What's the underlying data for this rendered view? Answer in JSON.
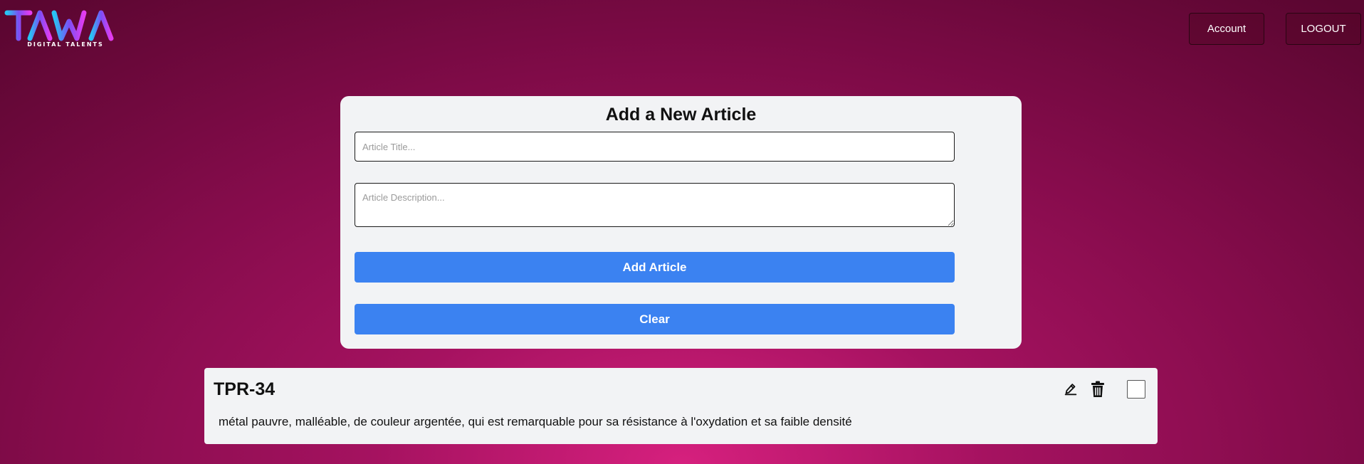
{
  "header": {
    "logo_text": "TAWA",
    "logo_subtitle": "DIGITAL TALENTS",
    "account_label": "Account",
    "logout_label": "LOGOUT"
  },
  "form": {
    "title": "Add a New Article",
    "title_placeholder": "Article Title...",
    "title_value": "",
    "description_placeholder": "Article Description...",
    "description_value": "",
    "add_label": "Add Article",
    "clear_label": "Clear"
  },
  "articles": [
    {
      "title": "TPR-34",
      "description": "métal pauvre, malléable, de couleur argentée, qui est remarquable pour sa résistance à l'oxydation et sa faible densité",
      "checked": false,
      "edit_icon": "pencil-icon",
      "delete_icon": "trash-icon"
    }
  ],
  "colors": {
    "background_center": "#d6207e",
    "background_edge": "#5a0630",
    "card": "#f2f3f5",
    "primary_button": "#3b82f1",
    "logo_gradient": [
      "#27c6f4",
      "#7a4ff5",
      "#e43cf0"
    ]
  }
}
